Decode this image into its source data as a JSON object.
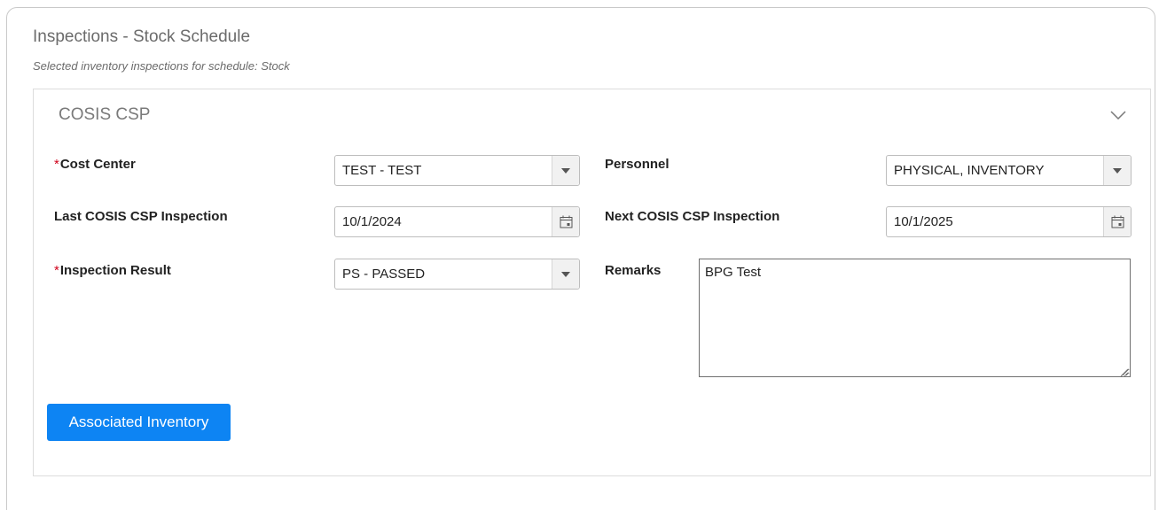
{
  "header": {
    "title": "Inspections - Stock Schedule",
    "subtitle": "Selected inventory inspections for schedule: Stock"
  },
  "panel": {
    "title": "COSIS CSP",
    "collapse_icon": "chevron-down-icon"
  },
  "form": {
    "cost_center": {
      "label": "Cost Center",
      "required": true,
      "value": "TEST - TEST"
    },
    "personnel": {
      "label": "Personnel",
      "required": false,
      "value": "PHYSICAL, INVENTORY"
    },
    "last_inspection": {
      "label": "Last COSIS CSP Inspection",
      "value": "10/1/2024"
    },
    "next_inspection": {
      "label": "Next COSIS CSP Inspection",
      "value": "10/1/2025"
    },
    "inspection_result": {
      "label": "Inspection Result",
      "required": true,
      "value": "PS - PASSED"
    },
    "remarks": {
      "label": "Remarks",
      "value": "BPG Test"
    },
    "required_marker": "*"
  },
  "actions": {
    "associated_inventory_label": "Associated Inventory"
  },
  "colors": {
    "primary": "#0d84f3",
    "required": "#d0021b",
    "border": "#bdbdbd"
  }
}
